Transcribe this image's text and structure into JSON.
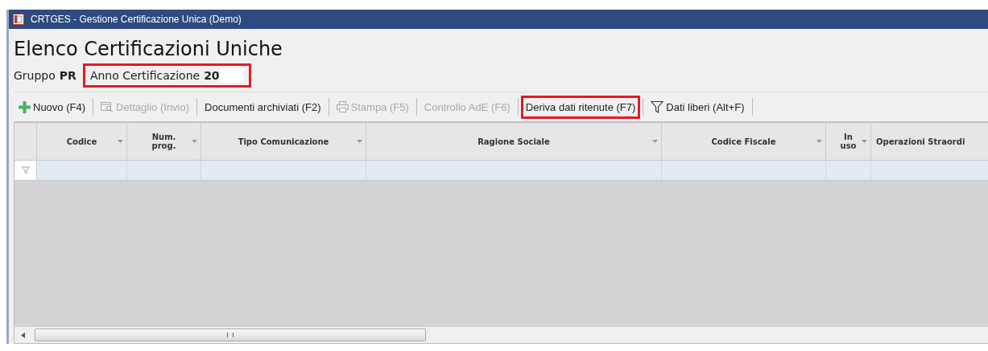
{
  "window": {
    "title": "CRTGES - Gestione Certificazione Unica  (Demo)"
  },
  "heading": "Elenco Certificazioni Uniche",
  "group": {
    "label": "Gruppo",
    "value": "PR"
  },
  "year": {
    "label": "Anno Certificazione",
    "value": "20",
    "highlighted": true
  },
  "toolbar": [
    {
      "label": "Nuovo (F4)",
      "kind": "plus",
      "disabled": false,
      "highlighted": false
    },
    {
      "label": "Dettaglio (Invio)",
      "kind": "detail",
      "disabled": true,
      "highlighted": false
    },
    {
      "label": "Documenti archiviati (F2)",
      "kind": "text",
      "disabled": false,
      "highlighted": false
    },
    {
      "label": "Stampa (F5)",
      "kind": "print",
      "disabled": true,
      "highlighted": false
    },
    {
      "label": "Controllo AdE (F6)",
      "kind": "text",
      "disabled": true,
      "highlighted": false
    },
    {
      "label": "Deriva dati ritenute (F7)",
      "kind": "text",
      "disabled": false,
      "highlighted": true
    },
    {
      "label": "Dati liberi (Alt+F)",
      "kind": "filter",
      "disabled": false,
      "highlighted": false
    }
  ],
  "table": {
    "columns": [
      {
        "label": "Codice",
        "dropdown": true
      },
      {
        "label": "Num. prog.",
        "dropdown": true
      },
      {
        "label": "Tipo Comunicazione",
        "dropdown": true
      },
      {
        "label": "Ragione Sociale",
        "dropdown": true
      },
      {
        "label": "Codice Fiscale",
        "dropdown": true
      },
      {
        "label": "In uso",
        "dropdown": true
      },
      {
        "label": "Operazioni Straordi",
        "dropdown": false
      }
    ]
  }
}
